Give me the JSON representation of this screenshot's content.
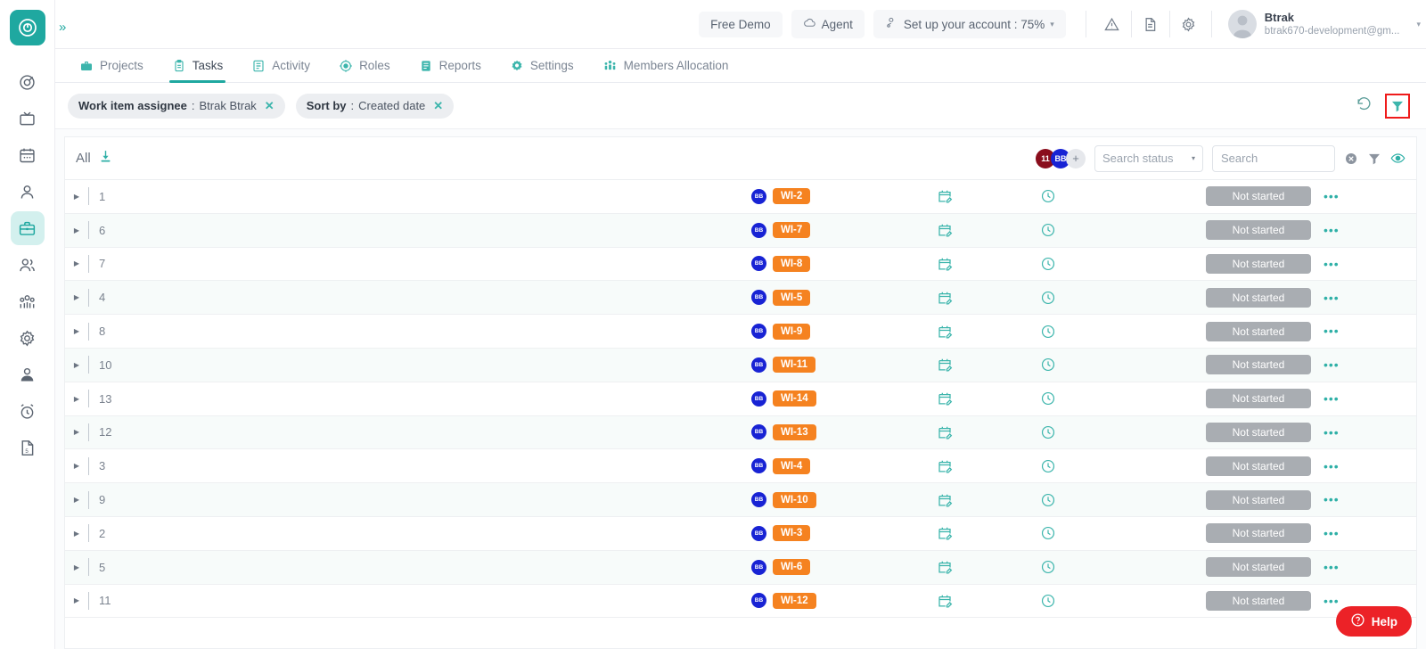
{
  "rail": {
    "logo_icon": "timer-logo-icon",
    "expand_icon": "chevrons-right-icon",
    "items": [
      {
        "name": "timer-icon",
        "active": false
      },
      {
        "name": "monitor-icon",
        "active": false
      },
      {
        "name": "calendar-icon",
        "active": false
      },
      {
        "name": "person-icon",
        "active": false
      },
      {
        "name": "briefcase-icon",
        "active": true
      },
      {
        "name": "people-icon",
        "active": false
      },
      {
        "name": "group-icon",
        "active": false
      },
      {
        "name": "gear-icon",
        "active": false
      },
      {
        "name": "user-badge-icon",
        "active": false
      },
      {
        "name": "alarm-clock-icon",
        "active": false
      },
      {
        "name": "document-icon",
        "active": false
      }
    ]
  },
  "header": {
    "free_demo_label": "Free Demo",
    "agent_label": "Agent",
    "agent_icon": "cloud-icon",
    "setup_label": "Set up your account : 75%",
    "setup_icon": "user-settings-icon",
    "setup_caret": "▾",
    "warning_icon": "warning-triangle-icon",
    "doc_icon": "document-icon",
    "settings_icon": "gear-icon",
    "avatar_icon": "avatar-placeholder",
    "user_name": "Btrak",
    "user_email": "btrak670-development@gm...",
    "user_caret": "▾"
  },
  "tabs": [
    {
      "label": "Projects",
      "icon": "briefcase-icon",
      "active": false
    },
    {
      "label": "Tasks",
      "icon": "clipboard-icon",
      "active": true
    },
    {
      "label": "Activity",
      "icon": "list-icon",
      "active": false
    },
    {
      "label": "Roles",
      "icon": "target-icon",
      "active": false
    },
    {
      "label": "Reports",
      "icon": "report-icon",
      "active": false
    },
    {
      "label": "Settings",
      "icon": "gear-icon",
      "active": false
    },
    {
      "label": "Members Allocation",
      "icon": "members-icon",
      "active": false
    }
  ],
  "filters": {
    "chips": [
      {
        "key": "Work item assignee",
        "sep": " : ",
        "value": "Btrak Btrak",
        "remove_icon": "close-icon"
      },
      {
        "key": "Sort by",
        "sep": " : ",
        "value": "Created date",
        "remove_icon": "close-icon"
      }
    ],
    "reset_icon": "reset-icon",
    "filter_icon": "funnel-icon",
    "filter_highlight_color": "#ef1b1b"
  },
  "toolbar": {
    "all_label": "All",
    "download_icon": "download-icon",
    "avatars": [
      {
        "label": "11",
        "color": "#8a0d1c",
        "name": "avatar-count"
      },
      {
        "label": "BB",
        "color": "#1823d4",
        "name": "avatar-bb"
      },
      {
        "label": "+",
        "color": "#e6e8ec",
        "name": "add-avatar"
      }
    ],
    "status_select_placeholder": "Search status",
    "status_caret": "▾",
    "search_placeholder": "Search",
    "clear_icon": "clear-circle-icon",
    "filter_icon": "funnel-icon",
    "eye_icon": "eye-icon"
  },
  "table": {
    "caret_icon": "▶",
    "more_icon": "•••",
    "calendar_icon": "calendar-edit-icon",
    "clock_icon": "clock-icon",
    "assignee_initials": "BB",
    "rows": [
      {
        "num": "1",
        "badge": "WI-2",
        "status": "Not started"
      },
      {
        "num": "6",
        "badge": "WI-7",
        "status": "Not started"
      },
      {
        "num": "7",
        "badge": "WI-8",
        "status": "Not started"
      },
      {
        "num": "4",
        "badge": "WI-5",
        "status": "Not started"
      },
      {
        "num": "8",
        "badge": "WI-9",
        "status": "Not started"
      },
      {
        "num": "10",
        "badge": "WI-11",
        "status": "Not started"
      },
      {
        "num": "13",
        "badge": "WI-14",
        "status": "Not started"
      },
      {
        "num": "12",
        "badge": "WI-13",
        "status": "Not started"
      },
      {
        "num": "3",
        "badge": "WI-4",
        "status": "Not started"
      },
      {
        "num": "9",
        "badge": "WI-10",
        "status": "Not started"
      },
      {
        "num": "2",
        "badge": "WI-3",
        "status": "Not started"
      },
      {
        "num": "5",
        "badge": "WI-6",
        "status": "Not started"
      },
      {
        "num": "11",
        "badge": "WI-12",
        "status": "Not started"
      }
    ]
  },
  "help": {
    "label": "Help",
    "icon": "question-circle-icon",
    "color": "#ec2227"
  },
  "colors": {
    "accent": "#1fa8a0",
    "badge": "#f58220",
    "status": "#a9adb2",
    "highlight": "#ef1b1b"
  }
}
